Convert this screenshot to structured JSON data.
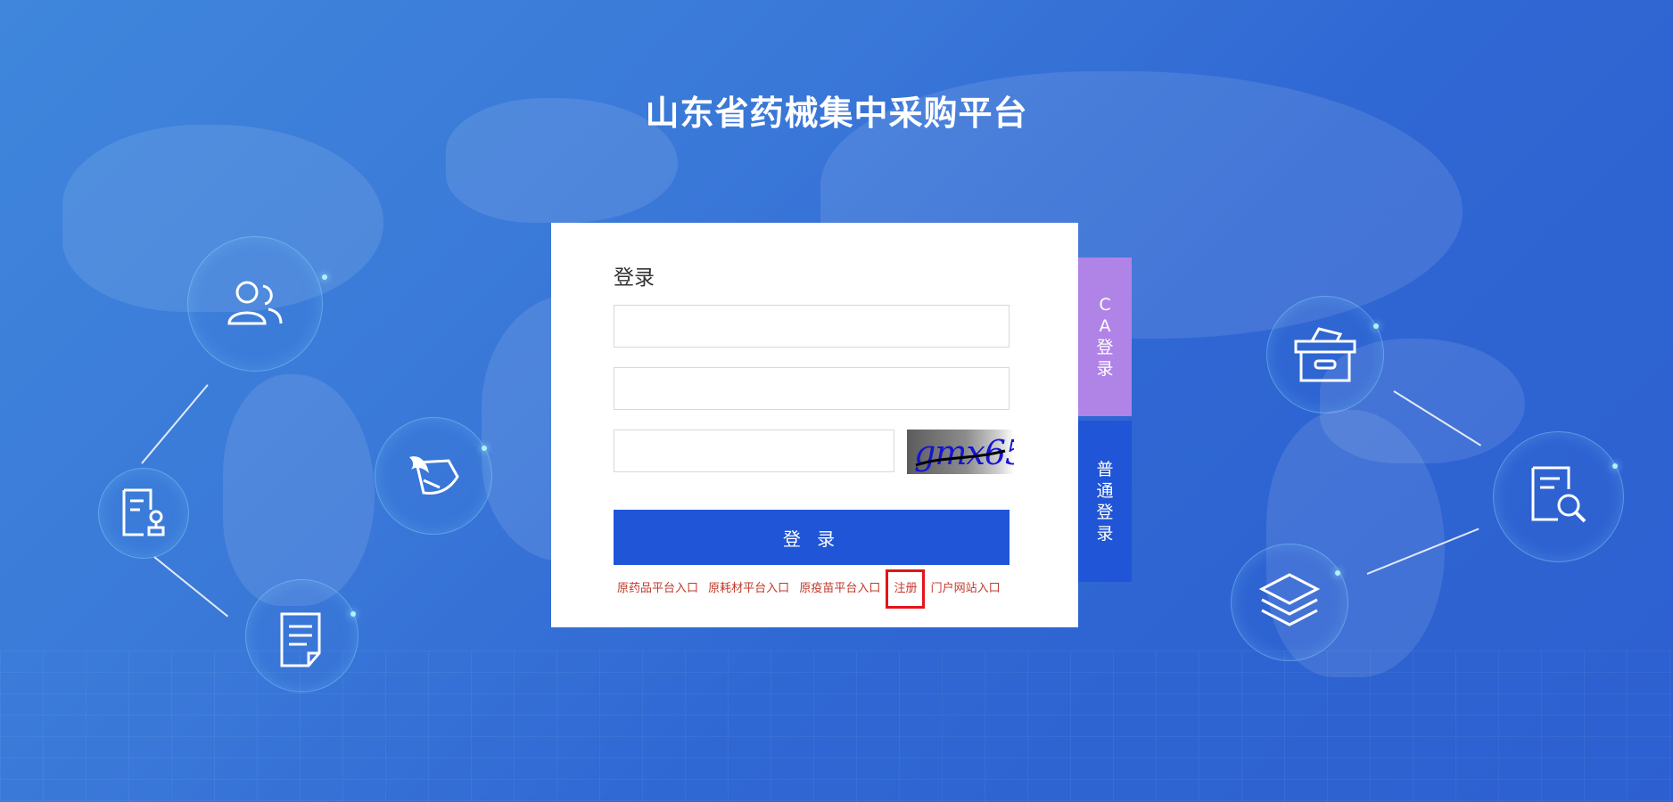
{
  "page_title": "山东省药械集中采购平台",
  "login": {
    "heading": "登录",
    "username": {
      "value": "",
      "placeholder": ""
    },
    "password": {
      "value": "",
      "placeholder": ""
    },
    "captcha": {
      "value": "",
      "placeholder": "",
      "image_text": "gmx65"
    },
    "submit_label": "登 录"
  },
  "links": [
    {
      "label": "原药品平台入口"
    },
    {
      "label": "原耗材平台入口"
    },
    {
      "label": "原疫苗平台入口"
    },
    {
      "label": "注册"
    },
    {
      "label": "门户网站入口"
    }
  ],
  "side_tabs": {
    "ca_login": "CA登录",
    "normal_login": "普通登录"
  },
  "decor_icons": [
    "users-icon",
    "seal-document-icon",
    "quill-icon",
    "document-icon",
    "archive-box-icon",
    "search-document-icon",
    "layers-icon"
  ],
  "colors": {
    "primary_button": "#1f55d6",
    "ca_tab": "#b084e6",
    "link_text": "#c0392b",
    "highlight_border": "#e3141a"
  }
}
